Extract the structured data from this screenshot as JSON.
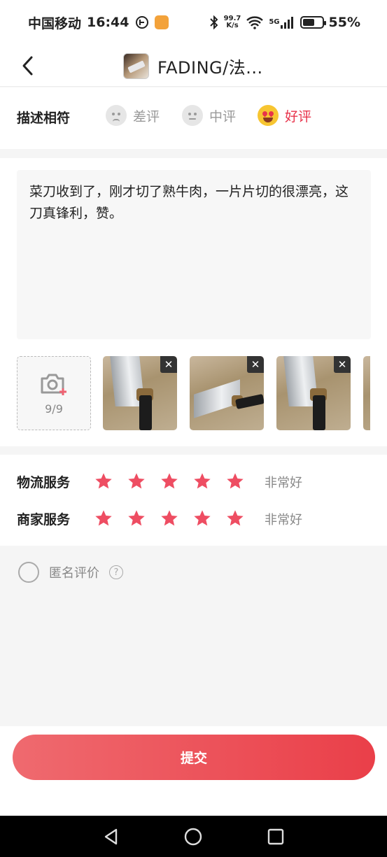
{
  "status_bar": {
    "carrier": "中国移动",
    "time": "16:44",
    "net_speed_value": "99.7",
    "net_speed_unit": "K/s",
    "network": "5G",
    "battery": "55%",
    "battery_level": 0.55
  },
  "header": {
    "title": "FADING/法..."
  },
  "rating": {
    "label": "描述相符",
    "options": [
      {
        "label": "差评",
        "selected": false
      },
      {
        "label": "中评",
        "selected": false
      },
      {
        "label": "好评",
        "selected": true
      }
    ]
  },
  "review": {
    "text": "菜刀收到了，刚才切了熟牛肉，一片片切的很漂亮，这刀真锋利，赞。",
    "photo_count": "9/9"
  },
  "services": [
    {
      "label": "物流服务",
      "stars": 5,
      "value": "非常好"
    },
    {
      "label": "商家服务",
      "stars": 5,
      "value": "非常好"
    }
  ],
  "anonymous": {
    "label": "匿名评价",
    "checked": false
  },
  "submit": {
    "label": "提交"
  },
  "colors": {
    "accent": "#e8334b",
    "star": "#ee4d62"
  }
}
